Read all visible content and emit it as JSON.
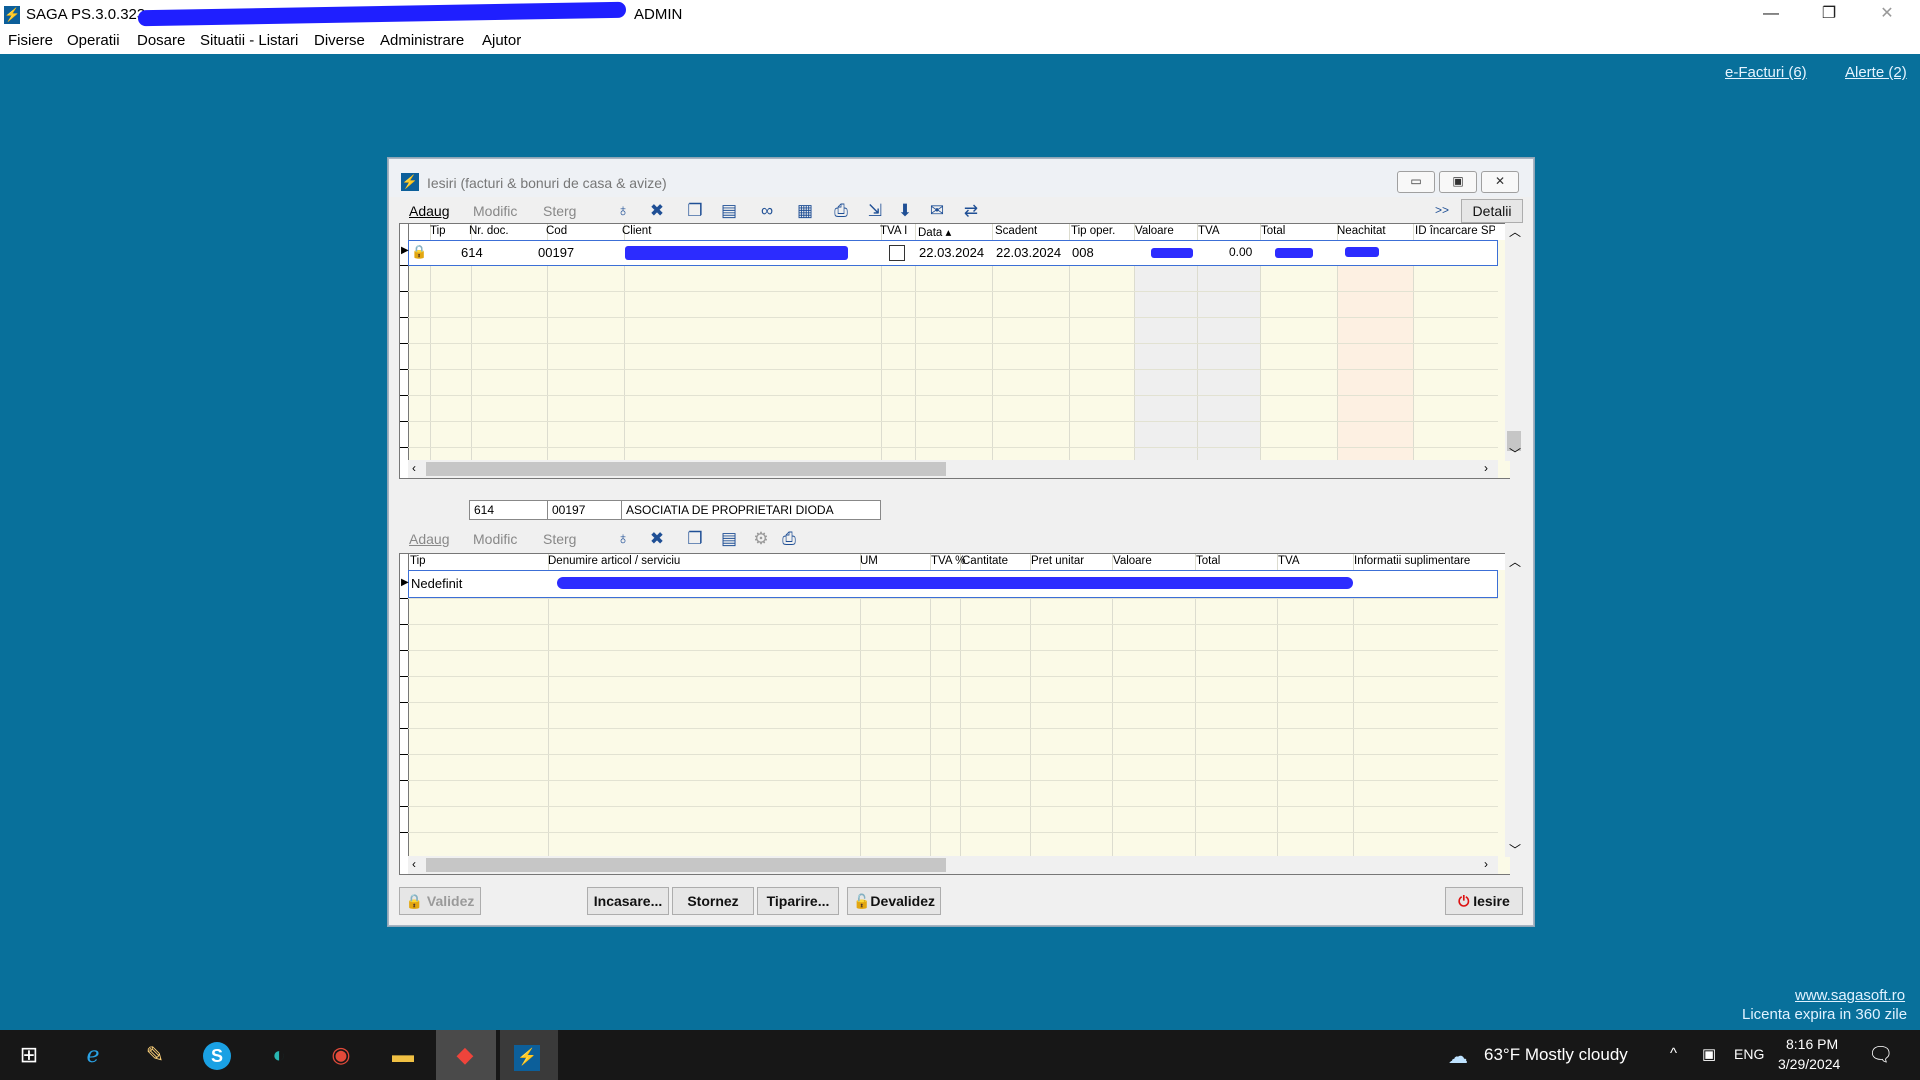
{
  "window": {
    "title": "SAGA PS.3.0.323",
    "user": "ADMIN",
    "controls": [
      "—",
      "❐",
      "✕"
    ]
  },
  "menu": [
    "Fisiere",
    "Operatii",
    "Dosare",
    "Situatii - Listari",
    "Diverse",
    "Administrare",
    "Ajutor"
  ],
  "toplinks": {
    "efacturi": "e-Facturi (6)",
    "alerte": "Alerte (2)"
  },
  "dialog": {
    "title": "Iesiri (facturi & bonuri de casa & avize)",
    "toolbar": {
      "adaug": "Adaug",
      "modific": "Modific",
      "sterg": "Sterg",
      "more": ">>",
      "detalii": "Detalii"
    },
    "columns": [
      "Tip",
      "Nr. doc.",
      "Cod",
      "Client",
      "TVA I",
      "Data ▴",
      "Scadent",
      "Tip oper.",
      "Valoare",
      "TVA",
      "Total",
      "Neachitat",
      "ID încarcare SPV"
    ],
    "row": {
      "nr": "614",
      "cod": "00197",
      "data": "22.03.2024",
      "scadent": "22.03.2024",
      "tipoper": "008",
      "tva": "0.00"
    },
    "detailbar": {
      "nr": "614",
      "cod": "00197",
      "client": "ASOCIATIA DE PROPRIETARI DIODA"
    },
    "toolbar2": {
      "adaug": "Adaug",
      "modific": "Modific",
      "sterg": "Sterg"
    },
    "columns2": [
      "Tip",
      "Denumire articol / serviciu",
      "UM",
      "TVA %",
      "Cantitate",
      "Pret unitar",
      "Valoare",
      "Total",
      "TVA",
      "Informatii suplimentare"
    ],
    "row2": {
      "tip": "Nedefinit"
    },
    "buttons": {
      "validez": "Validez",
      "incasare": "Incasare...",
      "stornez": "Stornez",
      "tiparire": "Tiparire...",
      "devalidez": "Devalidez",
      "iesire": "Iesire"
    }
  },
  "footer": {
    "site": "www.sagasoft.ro",
    "licenta": "Licenta expira in 360 zile"
  },
  "taskbar": {
    "weather": "63°F  Mostly cloudy",
    "lang": "ENG",
    "time": "8:16 PM",
    "date": "3/29/2024",
    "apps": [
      "start-icon",
      "ie-icon",
      "stylus-icon",
      "skype-icon",
      "edge-icon",
      "chrome-icon",
      "explorer-icon",
      "anydesk-icon",
      "saga-icon"
    ]
  },
  "colors": {
    "desktop": "#08709b",
    "grid": "#fbfae7",
    "redaction": "#1f1fff"
  }
}
